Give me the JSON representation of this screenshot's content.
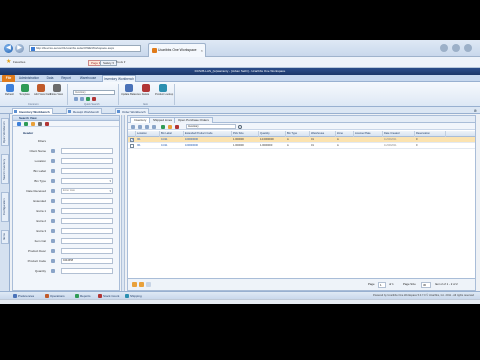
{
  "browser": {
    "address": "http://devcss-server01/ucaribs.suite/OWE/Workspace.aspx",
    "tab_title": "Ucaribbs One Workspace",
    "tab_close": "×",
    "back_glyph": "◀",
    "forward_glyph": "▶",
    "favorites_label": "Favorites",
    "page_chip": "Page ▾",
    "safety_chip": "Safety ▾",
    "rss_label": "Tools ▾"
  },
  "app": {
    "title": "DCS35-LAS_(w)warranty - [Joban Sethi] - Ucaribbs One Workspace"
  },
  "ribbon": {
    "tabs": [
      {
        "label": "File"
      },
      {
        "label": "Administration"
      },
      {
        "label": "Data"
      },
      {
        "label": "Report"
      },
      {
        "label": "Warehouse"
      },
      {
        "label": "Inventory Workbench"
      }
    ],
    "buttons": [
      {
        "label": "Refresh",
        "color": "#3d7fd9"
      },
      {
        "label": "Template",
        "color": "#2f9b56"
      },
      {
        "label": "Add View Field",
        "color": "#c05a2a"
      },
      {
        "label": "Close View",
        "color": "#6b6b6b"
      },
      {
        "label": "Update Balances",
        "color": "#4a72b8"
      },
      {
        "label": "Delete",
        "color": "#b13535"
      },
      {
        "label": "Product Lookup",
        "color": "#2b8fb0"
      }
    ],
    "search_value": "Inventory",
    "groups": [
      "Common",
      "Quick Search",
      "Item"
    ]
  },
  "doc_tabs": [
    {
      "label": "Inventory Workbench"
    },
    {
      "label": "Receipt Workbench"
    },
    {
      "label": "Order Workbench"
    }
  ],
  "left_strip": [
    "Open Workbench",
    "Search Inventory",
    "Configuration",
    "Items"
  ],
  "filter": {
    "header": "Search View",
    "group_label": "Header",
    "fields": [
      {
        "label": "Filters",
        "value": "",
        "combo": false,
        "group": true
      },
      {
        "label": "Client Name",
        "value": "",
        "combo": false
      },
      {
        "label": "Location",
        "value": "",
        "combo": false
      },
      {
        "label": "Bin Label",
        "value": "",
        "combo": false
      },
      {
        "label": "Bin Type",
        "value": "",
        "combo": true
      },
      {
        "label": "Date Received",
        "value": "Enter date",
        "combo": true
      },
      {
        "label": "Extended",
        "value": "",
        "combo": false
      },
      {
        "label": "Extra 1",
        "value": "",
        "combo": false
      },
      {
        "label": "Extra 2",
        "value": "",
        "combo": false
      },
      {
        "label": "Extra 3",
        "value": "",
        "combo": false
      },
      {
        "label": "Item Cat",
        "value": "",
        "combo": false
      },
      {
        "label": "Product Desc",
        "value": "",
        "combo": false
      },
      {
        "label": "Product Code",
        "value": "9444658",
        "combo": false
      },
      {
        "label": "Quantity",
        "value": "",
        "combo": false
      }
    ]
  },
  "grid": {
    "sub_tabs": [
      "Inventory",
      "Shipped Lines",
      "Open Purchase Orders"
    ],
    "search_value": "Inventory",
    "columns": [
      "Location",
      "Bin Label",
      "Extended Product Code",
      "Pick Size",
      "Quantity",
      "Bin Type",
      "Warehouse",
      "Zone",
      "License Plate",
      "Date Created",
      "Reservation"
    ],
    "rows": [
      {
        "selected": true,
        "cells": [
          "I01",
          "0-011",
          "100000000",
          "1.000000",
          "14.0000000",
          "A",
          "01",
          "A",
          "",
          "11/30/2011",
          "0"
        ]
      },
      {
        "selected": false,
        "cells": [
          "I01",
          "0-011",
          "100000000",
          "1.000000",
          "1.0000000",
          "A",
          "01",
          "A",
          "",
          "11/30/2011",
          "0"
        ]
      }
    ],
    "pager": {
      "page_label": "Page",
      "page_value": "1",
      "of_label": "of 1",
      "size_label": "Page Size",
      "size_value": "30",
      "items_label": "Item 2 of 1 - 2 of 2"
    }
  },
  "bottom_nav": [
    {
      "label": "Preferences",
      "color": "#4a72b8"
    },
    {
      "label": "Operations",
      "color": "#c05a2a"
    },
    {
      "label": "Reports",
      "color": "#2f9b56"
    },
    {
      "label": "Stock Count",
      "color": "#b13535"
    },
    {
      "label": "Shipping",
      "color": "#2b8fb0"
    }
  ],
  "copyright": "Powered by Ucaribbs One Workspace 5.0.7.0 © Ucaribbs, Inc. 2011 - All rights reserved"
}
